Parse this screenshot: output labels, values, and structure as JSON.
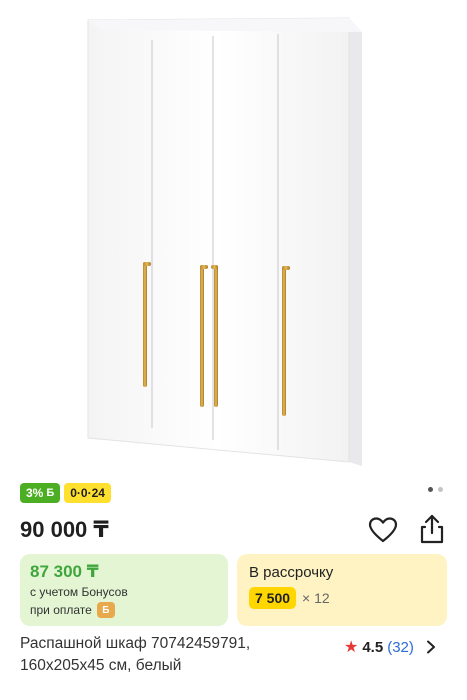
{
  "product": {
    "image_icon": "wardrobe-image",
    "badges": {
      "bonus": "3%",
      "bonus_icon": "Б",
      "installment": "0·0·24"
    },
    "carousel": {
      "total": 2,
      "active": 1
    },
    "price": "90 000 ₸",
    "bonus_card": {
      "price": "87 300 ₸",
      "line1": "с учетом Бонусов",
      "line2": "при оплате",
      "coin": "Б"
    },
    "installment_card": {
      "title": "В рассрочку",
      "amount": "7 500",
      "multiplier": "× 12"
    },
    "title": "Распашной шкаф 70742459791, 160x205x45 см, белый",
    "rating": {
      "value": "4.5",
      "count": "(32)"
    }
  },
  "colors": {
    "bonus_green": "#4caf23",
    "installment_yellow": "#ffe02e",
    "rating_star": "#e53935",
    "link_blue": "#2d6ad8"
  }
}
